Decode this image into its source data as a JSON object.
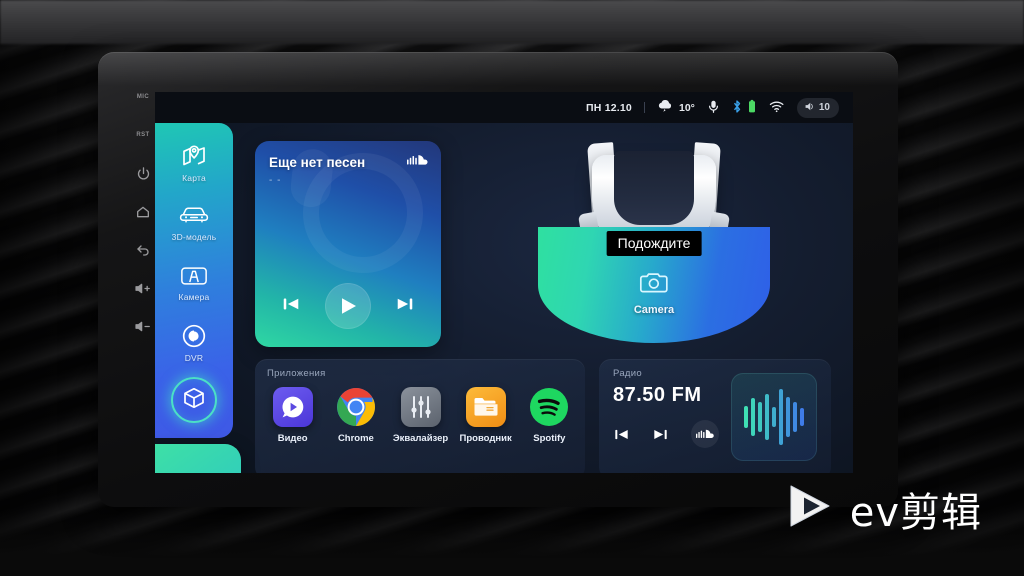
{
  "device": {
    "hardware_buttons": [
      {
        "name": "mic-indicator",
        "label": "MIC",
        "type": "text"
      },
      {
        "name": "reset-button",
        "label": "RST",
        "type": "text"
      },
      {
        "name": "power-button",
        "label": "power",
        "type": "icon"
      },
      {
        "name": "home-button",
        "label": "home",
        "type": "icon"
      },
      {
        "name": "back-button",
        "label": "back",
        "type": "icon"
      },
      {
        "name": "volume-up-button",
        "label": "volume up",
        "type": "icon"
      },
      {
        "name": "volume-down-button",
        "label": "volume down",
        "type": "icon"
      }
    ]
  },
  "statusbar": {
    "date": "ПН 12.10",
    "weather_icon": "cloud-rain-icon",
    "temperature": "10°",
    "mic_icon": "microphone-icon",
    "bluetooth_icon": "bluetooth-icon",
    "battery_icon": "battery-icon",
    "battery_color": "#4cd964",
    "wifi_icon": "wifi-icon",
    "volume_icon": "speaker-icon",
    "volume_level": "10"
  },
  "sidebar": {
    "items": [
      {
        "label": "Карта",
        "icon": "map-pin-icon"
      },
      {
        "label": "3D-модель",
        "icon": "car-front-icon"
      },
      {
        "label": "Камера",
        "icon": "camera-view-icon"
      },
      {
        "label": "DVR",
        "icon": "dvr-recorder-icon"
      }
    ],
    "active": {
      "label": "",
      "icon": "cube-icon"
    },
    "nav_panel": {
      "icon": "navigation-arrow-icon",
      "label": ""
    }
  },
  "music": {
    "title": "Еще нет песен",
    "subtitle": "- -",
    "source_icon": "soundcloud-icon",
    "prev_label": "previous-track",
    "play_label": "play",
    "next_label": "next-track"
  },
  "camera": {
    "tooltip": "Подождите",
    "label": "Camera",
    "icon": "camera-icon",
    "fan_gradient_from": "#2fe0a0",
    "fan_gradient_to": "#2f5fe8"
  },
  "apps": {
    "header": "Приложения",
    "items": [
      {
        "name": "Видео",
        "icon": "video-player-icon",
        "color": "#5b4ae0"
      },
      {
        "name": "Chrome",
        "icon": "chrome-icon",
        "color": "#ffffff"
      },
      {
        "name": "Эквалайзер",
        "icon": "equalizer-icon",
        "color": "#6b7280"
      },
      {
        "name": "Проводник",
        "icon": "file-manager-icon",
        "color": "#f5a623"
      },
      {
        "name": "Spotify",
        "icon": "spotify-icon",
        "color": "#1ed760"
      }
    ]
  },
  "radio": {
    "header": "Радио",
    "frequency": "87.50 FM",
    "prev_label": "previous-station",
    "next_label": "next-station",
    "source_icon": "soundcloud-icon",
    "visualizer_icon": "audio-waveform-icon",
    "wave_heights": [
      22,
      38,
      30,
      46,
      20,
      56,
      40,
      30,
      18
    ],
    "wave_color_from": "#3fe0b4",
    "wave_color_to": "#3f7ce8"
  },
  "watermark": {
    "icon": "play-triangle-icon",
    "text": "ev剪辑"
  }
}
